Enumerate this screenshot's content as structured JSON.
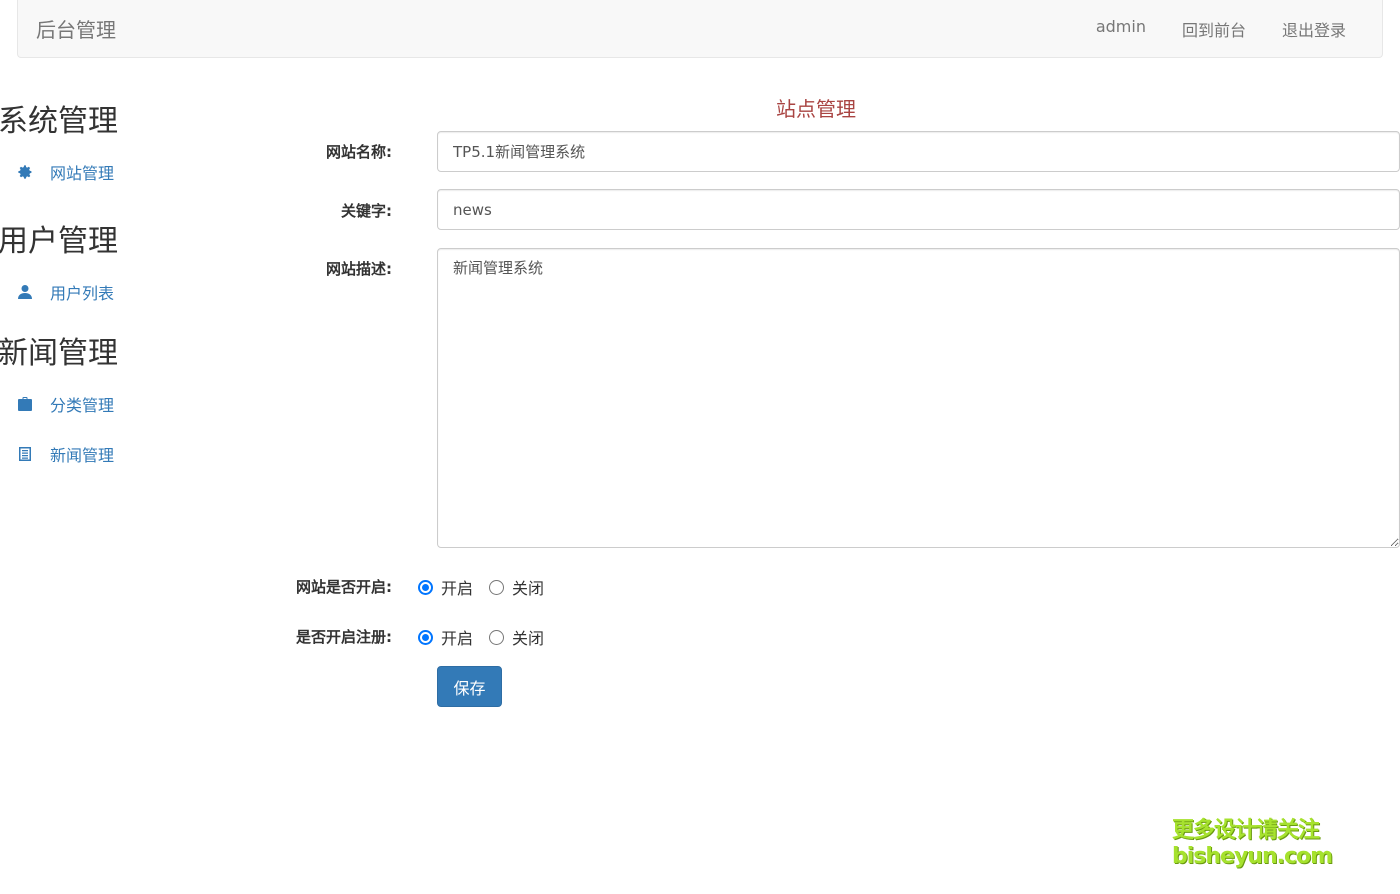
{
  "navbar": {
    "brand": "后台管理",
    "links": [
      "admin",
      "回到前台",
      "退出登录"
    ]
  },
  "sidebar": {
    "sections": [
      {
        "heading": "系统管理",
        "items": [
          {
            "label": "网站管理",
            "icon": "gear-icon"
          }
        ]
      },
      {
        "heading": "用户管理",
        "items": [
          {
            "label": "用户列表",
            "icon": "user-icon"
          }
        ]
      },
      {
        "heading": "新闻管理",
        "items": [
          {
            "label": "分类管理",
            "icon": "briefcase-icon"
          },
          {
            "label": "新闻管理",
            "icon": "list-icon"
          }
        ]
      }
    ]
  },
  "main": {
    "title": "站点管理",
    "site_name": {
      "label": "网站名称:",
      "value": "TP5.1新闻管理系统"
    },
    "keywords": {
      "label": "关键字:",
      "value": "news"
    },
    "description": {
      "label": "网站描述:",
      "value": "新闻管理系统"
    },
    "site_open": {
      "label": "网站是否开启:",
      "options": [
        "开启",
        "关闭"
      ],
      "selected": "开启"
    },
    "register_open": {
      "label": "是否开启注册:",
      "options": [
        "开启",
        "关闭"
      ],
      "selected": "开启"
    },
    "save_label": "保存"
  },
  "watermark": {
    "line1": "更多设计请关注",
    "line2": "bisheyun.com"
  },
  "colors": {
    "accent": "#337ab7",
    "title": "#a94442",
    "radio": "#0075ff"
  }
}
